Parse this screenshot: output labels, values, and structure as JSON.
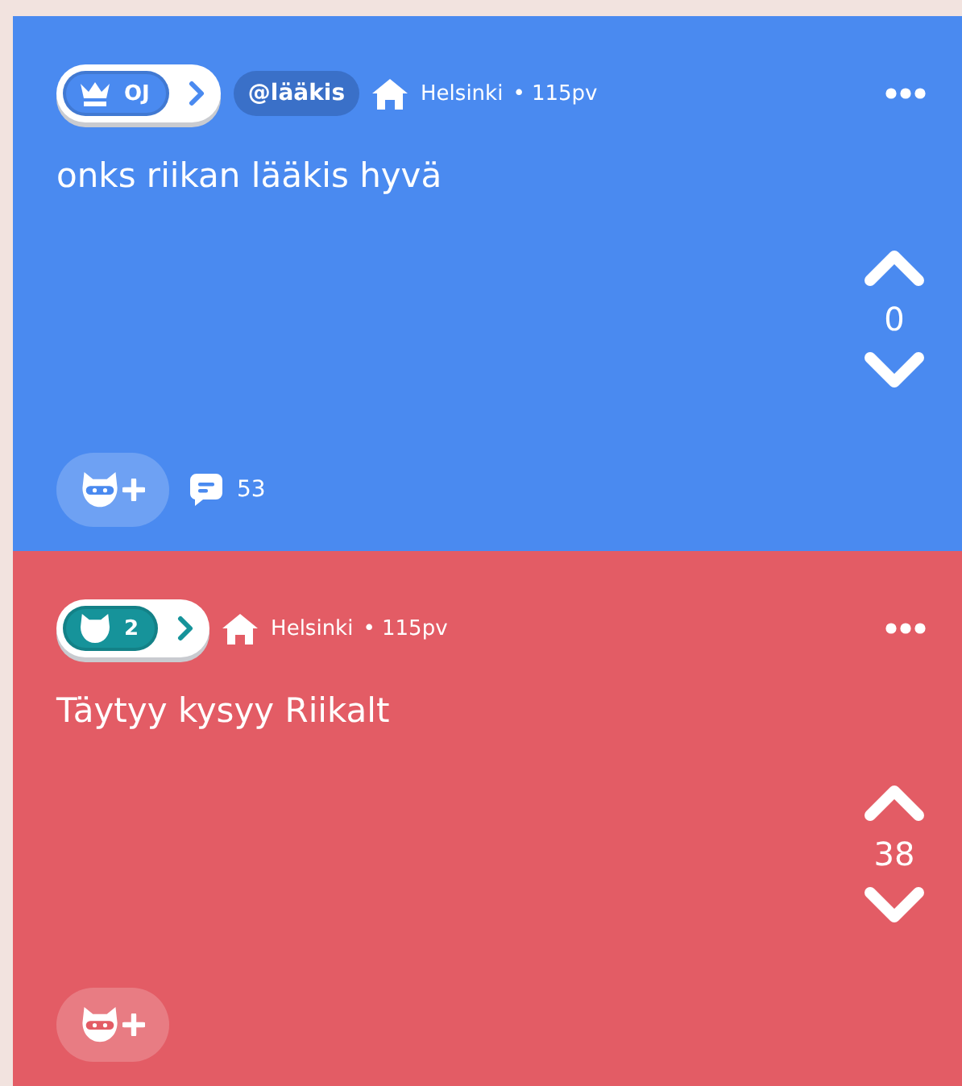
{
  "posts": [
    {
      "color": "#4a8af0",
      "badge": {
        "kind": "crown",
        "label": "OJ",
        "color": "#4a8af0"
      },
      "tag": "@lääkis",
      "location": "Helsinki",
      "age": "• 115pv",
      "text": "onks riikan lääkis hyvä",
      "votes": "0",
      "comments": "53"
    },
    {
      "color": "#e35c65",
      "badge": {
        "kind": "cat",
        "label": "2",
        "color": "#16939a"
      },
      "location": "Helsinki",
      "age": "• 115pv",
      "text": "Täytyy kysyy Riikalt",
      "votes": "38"
    }
  ]
}
